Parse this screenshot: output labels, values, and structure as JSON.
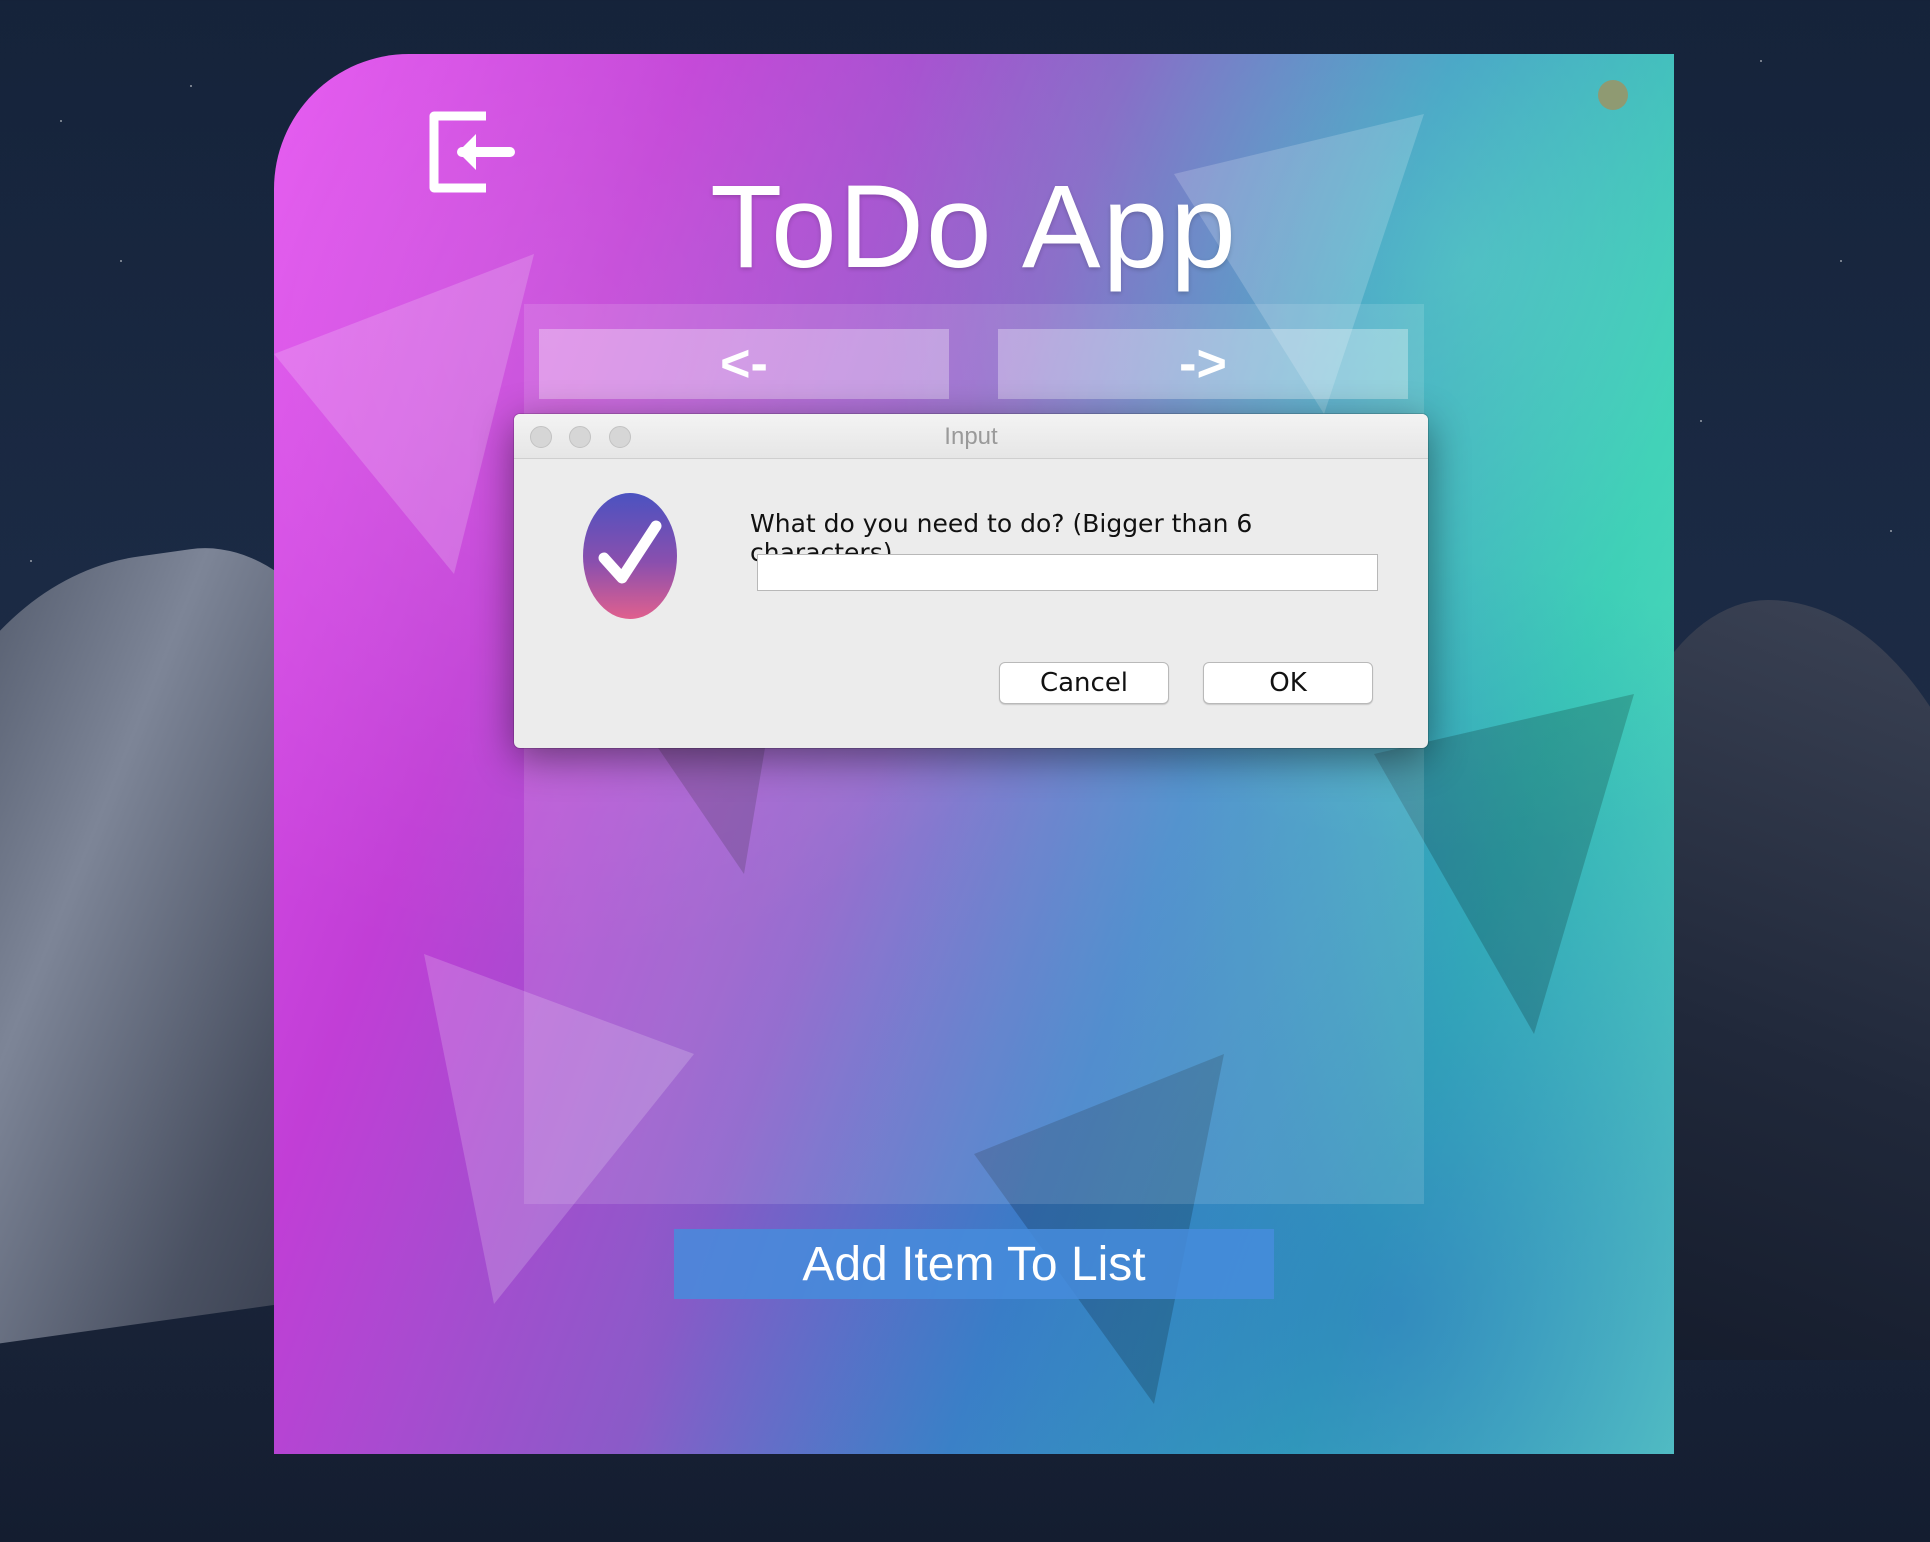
{
  "app": {
    "title": "ToDo App",
    "prev_label": "<-",
    "next_label": "->",
    "add_label": "Add Item To List",
    "exit_icon": "exit-icon",
    "close_icon": "close-dot-icon"
  },
  "dialog": {
    "title": "Input",
    "message": "What do you need to do? (Bigger than 6 characters)",
    "input_value": "",
    "cancel_label": "Cancel",
    "ok_label": "OK",
    "icon": "checkmark-badge-icon"
  },
  "colors": {
    "gradient_magenta": "#e554f0",
    "gradient_teal": "#35c8b4",
    "add_button": "#468cdc"
  }
}
